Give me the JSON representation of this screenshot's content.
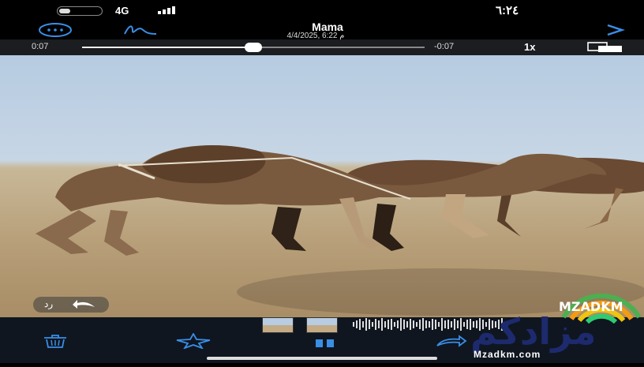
{
  "status_bar": {
    "time": "٦:٢٤",
    "network": "4G"
  },
  "header": {
    "title": "Mama",
    "subtitle": "4/4/2025, 6:22 م"
  },
  "scrubber": {
    "elapsed": "0:07",
    "remaining": "-0:07",
    "progress": 0.5,
    "speed": "1x"
  },
  "overlay": {
    "reply_label": "رد"
  },
  "watermark": {
    "brand_text": "مزادكم",
    "url": "Mzadkm.com"
  },
  "colors": {
    "accent": "#3a8ee6",
    "toolbar_bg": "#0f1620"
  },
  "icons": {
    "more": "more-circle-icon",
    "draw": "signature-icon",
    "forward": "chevron-right-icon",
    "pip": "picture-in-picture-icon",
    "delete": "trash-icon",
    "favorite": "star-icon",
    "pause": "pause-icon",
    "share": "share-arrow-icon"
  }
}
